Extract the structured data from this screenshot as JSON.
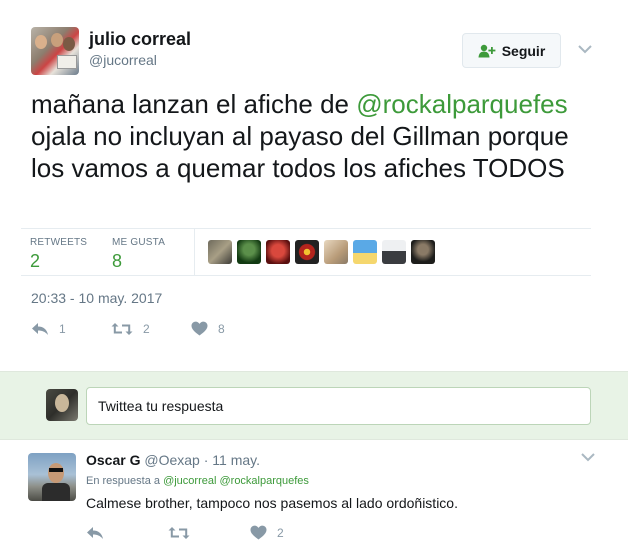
{
  "tweet": {
    "fullname": "julio correal",
    "username": "@jucorreal",
    "follow_label": "Seguir",
    "text_before": "mañana lanzan el afiche de ",
    "text_mention": "@rockalparquefes",
    "text_after": " ojala no incluyan al payaso del Gillman porque los vamos a quemar todos los afiches TODOS",
    "stats": {
      "retweets_label": "RETWEETS",
      "retweets_value": "2",
      "likes_label": "ME GUSTA",
      "likes_value": "8"
    },
    "timestamp": "20:33 - 10 may. 2017",
    "actions": {
      "reply_count": "1",
      "retweet_count": "2",
      "like_count": "8"
    }
  },
  "reply_box": {
    "placeholder": "Twittea tu respuesta"
  },
  "reply": {
    "fullname": "Oscar G",
    "username": "@Oexap",
    "time": "· 11 may.",
    "in_reply_prefix": "En respuesta a ",
    "in_reply_mention1": "@jucorreal",
    "in_reply_mention2": "@rockalparquefes",
    "text": "Calmese brother, tampoco nos pasemos al lado ordoñistico.",
    "like_count": "2"
  },
  "colors": {
    "accent_green": "#3d9a3a",
    "reply_bar_bg": "#e8f3e6",
    "muted_text": "#657786"
  }
}
